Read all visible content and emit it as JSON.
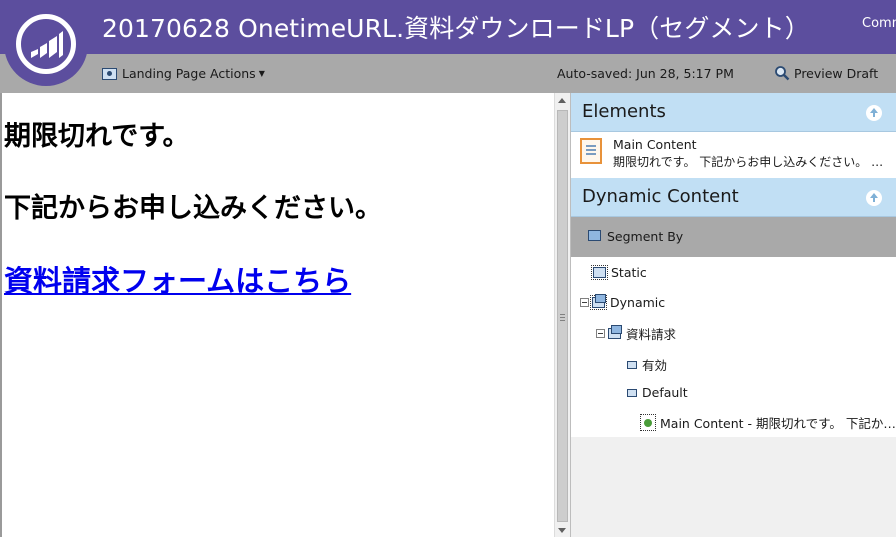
{
  "header": {
    "title": "20170628 OnetimeURL.資料ダウンロードLP（セグメント）",
    "right_text": "Comm"
  },
  "toolbar": {
    "actions_label": "Landing Page Actions",
    "autosaved": "Auto-saved: Jun 28, 5:17 PM",
    "preview_label": "Preview Draft"
  },
  "canvas": {
    "line1": "期限切れです。",
    "line2": "下記からお申し込みください。",
    "link": "資料請求フォームはこちら"
  },
  "panel": {
    "elements_header": "Elements",
    "element": {
      "title": "Main Content",
      "subtitle": "期限切れです。 下記からお申し込みください。 …"
    },
    "dynamic_header": "Dynamic Content",
    "segment_by": "Segment By",
    "tree": {
      "static": "Static",
      "dynamic": "Dynamic",
      "segment": "資料請求",
      "valid": "有効",
      "default": "Default",
      "content": "Main Content - 期限切れです。 下記か…"
    }
  },
  "colors": {
    "header_bg": "#5c4e9e",
    "toolbar_bg": "#a9a9a9",
    "section_header_bg": "#c1dff4",
    "link": "#0000ee"
  }
}
